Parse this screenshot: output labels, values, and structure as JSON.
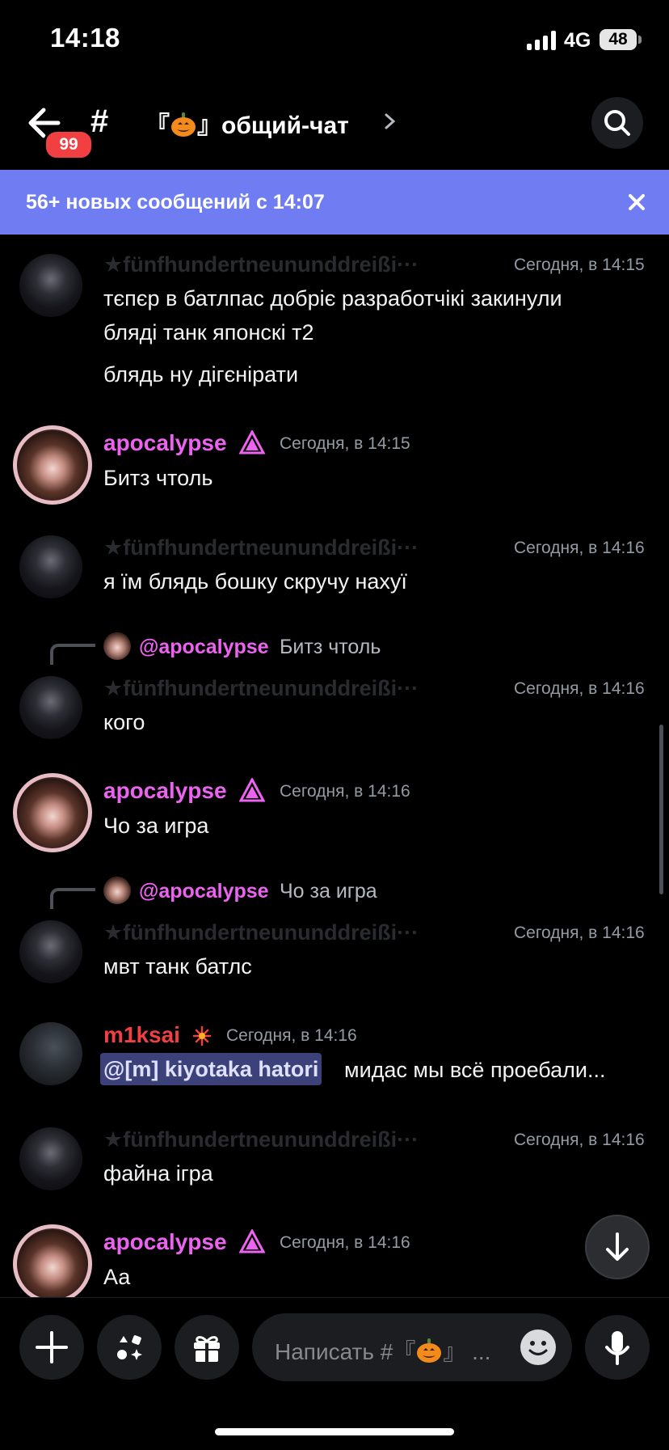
{
  "status_bar": {
    "time": "14:18",
    "network": "4G",
    "battery": "48"
  },
  "header": {
    "badge": "99",
    "hash": "#",
    "channel_name_left": "『",
    "channel_name_right": "』общий-чат",
    "channel_emoji": "pumpkin-icon"
  },
  "banner": {
    "text": "56+ новых сообщений с 14:07"
  },
  "messages": [
    {
      "author": "★fünfhundertneununddreißi···",
      "time": "Сегодня, в 14:15",
      "lines": [
        "тєпєр в батлпас добріє разработчікі закинули",
        "бляді танк японскі т2",
        "блядь ну дігєнірати"
      ]
    },
    {
      "author": "apocalypse",
      "time": "Сегодня, в 14:15",
      "lines": [
        "Битз чтоль"
      ]
    },
    {
      "author": "★fünfhundertneununddreißi···",
      "time": "Сегодня, в 14:16",
      "lines": [
        "я їм блядь бошку скручу нахуї"
      ]
    },
    {
      "reply_mention": "@apocalypse",
      "reply_text": "Битз чтоль",
      "author": "★fünfhundertneununddreißi···",
      "time": "Сегодня, в 14:16",
      "lines": [
        "кого"
      ]
    },
    {
      "author": "apocalypse",
      "time": "Сегодня, в 14:16",
      "lines": [
        "Чо за игра"
      ]
    },
    {
      "reply_mention": "@apocalypse",
      "reply_text": "Чо за игра",
      "author": "★fünfhundertneununddreißi···",
      "time": "Сегодня, в 14:16",
      "lines": [
        "мвт танк батлс"
      ]
    },
    {
      "author": "m1ksai",
      "time": "Сегодня, в 14:16",
      "mention": "@[m] kiyotaka hatori",
      "lines": [
        "мидас мы всё проебали..."
      ]
    },
    {
      "author": "★fünfhundertneununddreißi···",
      "time": "Сегодня, в 14:16",
      "lines": [
        "файна ігра"
      ]
    },
    {
      "author": "apocalypse",
      "time": "Сегодня, в 14:16",
      "lines": [
        "Аа"
      ]
    }
  ],
  "composer": {
    "placeholder_left": "Написать #『",
    "placeholder_right": "』 ..."
  },
  "colors": {
    "banner": "#6f7cf2",
    "apocalypse": "#ec63f0",
    "m1ksai": "#f23f42",
    "badge": "#f23f42",
    "mention_bg": "#3c4279"
  }
}
